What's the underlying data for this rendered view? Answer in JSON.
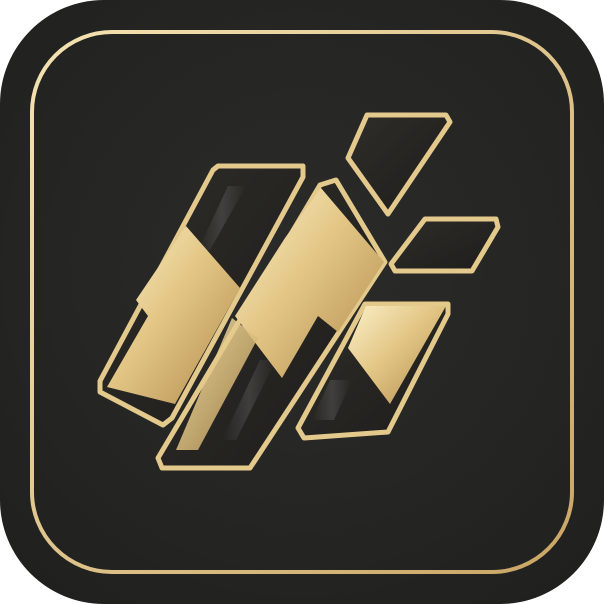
{
  "icon": {
    "name": "gold-bars-app-icon",
    "colors": {
      "background": "#252523",
      "frame": "#d9c08b",
      "gold_light": "#f6e6b8",
      "gold_mid": "#d4b06a",
      "gold_dark": "#a9844a",
      "inner_dark": "#1f1f1d"
    }
  }
}
